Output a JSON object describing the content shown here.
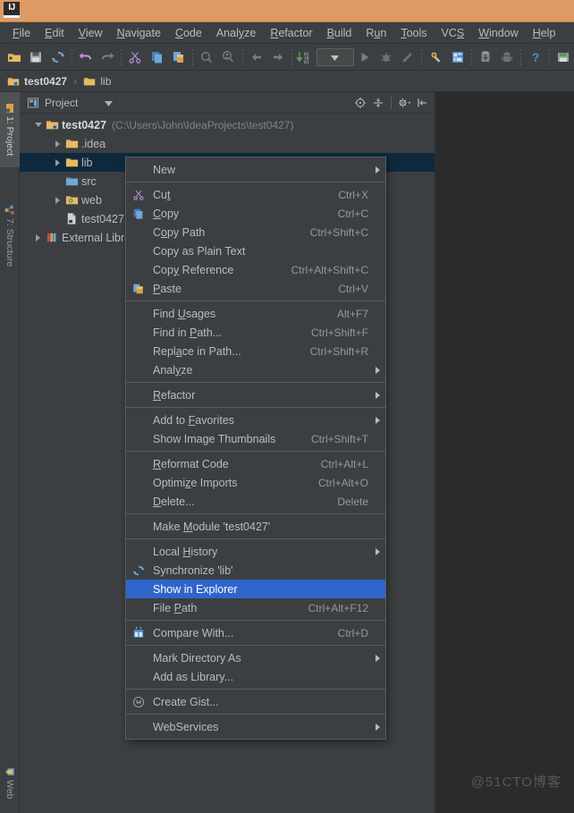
{
  "window": {
    "logo_text": "IJ",
    "titlebar_color": "#dd9a64"
  },
  "menubar": {
    "items": [
      {
        "pre": "",
        "mn": "F",
        "post": "ile"
      },
      {
        "pre": "",
        "mn": "E",
        "post": "dit"
      },
      {
        "pre": "",
        "mn": "V",
        "post": "iew"
      },
      {
        "pre": "",
        "mn": "N",
        "post": "avigate"
      },
      {
        "pre": "",
        "mn": "C",
        "post": "ode"
      },
      {
        "pre": "Anal",
        "mn": "y",
        "post": "ze"
      },
      {
        "pre": "",
        "mn": "R",
        "post": "efactor"
      },
      {
        "pre": "",
        "mn": "B",
        "post": "uild"
      },
      {
        "pre": "R",
        "mn": "u",
        "post": "n"
      },
      {
        "pre": "",
        "mn": "T",
        "post": "ools"
      },
      {
        "pre": "VC",
        "mn": "S",
        "post": ""
      },
      {
        "pre": "",
        "mn": "W",
        "post": "indow"
      },
      {
        "pre": "",
        "mn": "H",
        "post": "elp"
      }
    ]
  },
  "toolbar": {
    "buttons": [
      "open-project-icon",
      "save-all-icon",
      "synchronize-icon",
      "undo-icon",
      "redo-icon",
      "cut-icon",
      "copy-icon",
      "paste-icon",
      "find-icon",
      "find-usages-icon",
      "back-icon",
      "forward-icon",
      "toggle-bookmarks-icon",
      "run-configurations-dropdown",
      "run-icon",
      "debug-icon",
      "coverage-icon",
      "project-structure-icon",
      "settings-icon",
      "sdk-manager-icon",
      "avd-manager-icon",
      "help-icon",
      "android-sync-icon"
    ]
  },
  "breadcrumbs": {
    "items": [
      {
        "label": "test0427",
        "icon": "module-folder-icon",
        "bold": true
      },
      {
        "label": "lib",
        "icon": "folder-icon",
        "bold": false
      }
    ],
    "separator": "›"
  },
  "toolstrip": {
    "tabs": [
      {
        "label": "1: Project",
        "selected": true,
        "icon": "project-icon"
      },
      {
        "label": "7: Structure",
        "selected": false,
        "icon": "structure-icon"
      }
    ],
    "bottom_tab": {
      "label": "Web",
      "icon": "web-icon"
    }
  },
  "project_panel": {
    "title": "Project",
    "view_dropdown_icon": "chevron-down-icon",
    "panel_icon": "project-view-icon",
    "actions": [
      "locate-icon",
      "collapse-all-icon",
      "settings-gear-icon",
      "hide-icon"
    ],
    "tree": [
      {
        "label": "test0427",
        "path": "(C:\\Users\\John\\IdeaProjects\\test0427)",
        "indent": 0,
        "twist": "open",
        "icon": "module-folder-icon",
        "bold": true,
        "selected": false
      },
      {
        "label": ".idea",
        "path": "",
        "indent": 1,
        "twist": "closed",
        "icon": "folder-icon",
        "bold": false,
        "selected": false
      },
      {
        "label": "lib",
        "path": "",
        "indent": 1,
        "twist": "closed",
        "icon": "folder-icon",
        "bold": false,
        "selected": true
      },
      {
        "label": "src",
        "path": "",
        "indent": 1,
        "twist": "none",
        "icon": "source-folder-icon",
        "bold": false,
        "selected": false
      },
      {
        "label": "web",
        "path": "",
        "indent": 1,
        "twist": "closed",
        "icon": "web-folder-icon",
        "bold": false,
        "selected": false
      },
      {
        "label": "test0427.iml",
        "path": "",
        "indent": 1,
        "twist": "none",
        "icon": "iml-file-icon",
        "bold": false,
        "selected": false
      },
      {
        "label": "External Libraries",
        "path": "",
        "indent": 0,
        "twist": "closed",
        "icon": "libraries-icon",
        "bold": false,
        "selected": false
      }
    ]
  },
  "context_menu": {
    "items": [
      {
        "type": "item",
        "pre": "",
        "mn": "",
        "post": "New",
        "accel": "",
        "icon": "",
        "submenu": true,
        "selected": false
      },
      {
        "type": "separator"
      },
      {
        "type": "item",
        "pre": "Cu",
        "mn": "t",
        "post": "",
        "accel": "Ctrl+X",
        "icon": "cut-icon",
        "submenu": false,
        "selected": false
      },
      {
        "type": "item",
        "pre": "",
        "mn": "C",
        "post": "opy",
        "accel": "Ctrl+C",
        "icon": "copy-icon",
        "submenu": false,
        "selected": false
      },
      {
        "type": "item",
        "pre": "C",
        "mn": "o",
        "post": "py Path",
        "accel": "Ctrl+Shift+C",
        "icon": "",
        "submenu": false,
        "selected": false
      },
      {
        "type": "item",
        "pre": "Copy as Plain Text",
        "mn": "",
        "post": "",
        "accel": "",
        "icon": "",
        "submenu": false,
        "selected": false
      },
      {
        "type": "item",
        "pre": "Cop",
        "mn": "y",
        "post": " Reference",
        "accel": "Ctrl+Alt+Shift+C",
        "icon": "",
        "submenu": false,
        "selected": false
      },
      {
        "type": "item",
        "pre": "",
        "mn": "P",
        "post": "aste",
        "accel": "Ctrl+V",
        "icon": "paste-icon",
        "submenu": false,
        "selected": false
      },
      {
        "type": "separator"
      },
      {
        "type": "item",
        "pre": "Find ",
        "mn": "U",
        "post": "sages",
        "accel": "Alt+F7",
        "icon": "",
        "submenu": false,
        "selected": false
      },
      {
        "type": "item",
        "pre": "Find in ",
        "mn": "P",
        "post": "ath...",
        "accel": "Ctrl+Shift+F",
        "icon": "",
        "submenu": false,
        "selected": false
      },
      {
        "type": "item",
        "pre": "Repl",
        "mn": "a",
        "post": "ce in Path...",
        "accel": "Ctrl+Shift+R",
        "icon": "",
        "submenu": false,
        "selected": false
      },
      {
        "type": "item",
        "pre": "Anal",
        "mn": "y",
        "post": "ze",
        "accel": "",
        "icon": "",
        "submenu": true,
        "selected": false
      },
      {
        "type": "separator"
      },
      {
        "type": "item",
        "pre": "",
        "mn": "R",
        "post": "efactor",
        "accel": "",
        "icon": "",
        "submenu": true,
        "selected": false
      },
      {
        "type": "separator"
      },
      {
        "type": "item",
        "pre": "Add to ",
        "mn": "F",
        "post": "avorites",
        "accel": "",
        "icon": "",
        "submenu": true,
        "selected": false
      },
      {
        "type": "item",
        "pre": "Show Image Thumbnails",
        "mn": "",
        "post": "",
        "accel": "Ctrl+Shift+T",
        "icon": "",
        "submenu": false,
        "selected": false
      },
      {
        "type": "separator"
      },
      {
        "type": "item",
        "pre": "",
        "mn": "R",
        "post": "eformat Code",
        "accel": "Ctrl+Alt+L",
        "icon": "",
        "submenu": false,
        "selected": false
      },
      {
        "type": "item",
        "pre": "Optimi",
        "mn": "z",
        "post": "e Imports",
        "accel": "Ctrl+Alt+O",
        "icon": "",
        "submenu": false,
        "selected": false
      },
      {
        "type": "item",
        "pre": "",
        "mn": "D",
        "post": "elete...",
        "accel": "Delete",
        "icon": "",
        "submenu": false,
        "selected": false
      },
      {
        "type": "separator"
      },
      {
        "type": "item",
        "pre": "Make ",
        "mn": "M",
        "post": "odule 'test0427'",
        "accel": "",
        "icon": "",
        "submenu": false,
        "selected": false
      },
      {
        "type": "separator"
      },
      {
        "type": "item",
        "pre": "Local ",
        "mn": "H",
        "post": "istory",
        "accel": "",
        "icon": "",
        "submenu": true,
        "selected": false
      },
      {
        "type": "item",
        "pre": "Synchronize 'lib'",
        "mn": "",
        "post": "",
        "accel": "",
        "icon": "synchronize-icon",
        "submenu": false,
        "selected": false
      },
      {
        "type": "item",
        "pre": "Show in Explorer",
        "mn": "",
        "post": "",
        "accel": "",
        "icon": "",
        "submenu": false,
        "selected": true
      },
      {
        "type": "item",
        "pre": "File ",
        "mn": "P",
        "post": "ath",
        "accel": "Ctrl+Alt+F12",
        "icon": "",
        "submenu": false,
        "selected": false
      },
      {
        "type": "separator"
      },
      {
        "type": "item",
        "pre": "Compare With...",
        "mn": "",
        "post": "",
        "accel": "Ctrl+D",
        "icon": "compare-icon",
        "submenu": false,
        "selected": false
      },
      {
        "type": "separator"
      },
      {
        "type": "item",
        "pre": "Mark Directory As",
        "mn": "",
        "post": "",
        "accel": "",
        "icon": "",
        "submenu": true,
        "selected": false
      },
      {
        "type": "item",
        "pre": "Add as Library...",
        "mn": "",
        "post": "",
        "accel": "",
        "icon": "",
        "submenu": false,
        "selected": false
      },
      {
        "type": "separator"
      },
      {
        "type": "item",
        "pre": "Create Gist...",
        "mn": "",
        "post": "",
        "accel": "",
        "icon": "gist-icon",
        "submenu": false,
        "selected": false
      },
      {
        "type": "separator"
      },
      {
        "type": "item",
        "pre": "WebServices",
        "mn": "",
        "post": "",
        "accel": "",
        "icon": "",
        "submenu": true,
        "selected": false
      }
    ]
  },
  "editor": {
    "watermark": "@51CTO博客"
  },
  "colors": {
    "panel_bg": "#3c3f41",
    "editor_bg": "#2b2b2b",
    "selection_blue": "#2f65ca",
    "tree_selection": "#0d293e",
    "accent_orange": "#dd9a64",
    "text": "#bbbbbb"
  }
}
